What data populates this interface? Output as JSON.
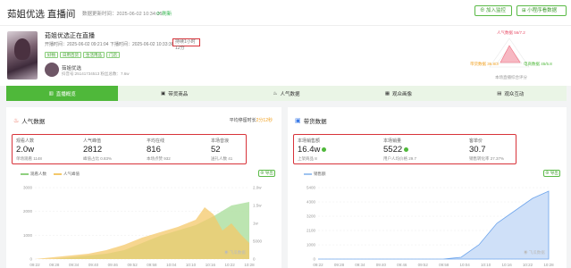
{
  "header": {
    "title": "茹姐优选  直播间",
    "updated": "数据更新时间：2025-06-02 10:34:25",
    "refresh": "⟳ 刷新",
    "follow": "⊕ 加入监控",
    "compare": "⊞ 小程序看数据"
  },
  "info": {
    "live_title": "茹姐优选正在直播",
    "start": "开播时间：2025-06-02 09:21:04",
    "end": "下播时间：2025-06-02 10:33:36",
    "duration": "持续1小时12分",
    "tags": [
      "好物",
      "日用百货",
      "生活用品",
      "门店"
    ],
    "shop": "茹姐优选",
    "shop_sub": "抖音号:25141734513   粉丝总数：7.6w",
    "radar": {
      "top": "人气数据 56/7.2",
      "left": "带货数据 36.8/3",
      "right": "电商数据 45/5.8",
      "bottom": "本场直播综合评分"
    }
  },
  "tabs": [
    "直播概览",
    "带货商品",
    "人气数据",
    "观众画像",
    "观众互动"
  ],
  "left": {
    "title": "人气数据",
    "right_note": "平均停留时长",
    "right_val": "2分12秒",
    "stats": [
      {
        "label": "观看人数",
        "value": "2.0w",
        "sub": "单场观看 1148"
      },
      {
        "label": "人气峰值",
        "value": "2812",
        "sub": "峰值占比 0.83%"
      },
      {
        "label": "平均在线",
        "value": "816",
        "sub": "本场点赞 932"
      },
      {
        "label": "本场音浪",
        "value": "52",
        "sub": "送礼人数 41"
      }
    ],
    "legend": [
      "观看人数",
      "人气峰值"
    ],
    "export": "⊕ 导出",
    "x_ticks": [
      "09:22",
      "09:28",
      "09:34",
      "09:40",
      "09:46",
      "09:52",
      "09:58",
      "10:04",
      "10:10",
      "10:16",
      "10:22",
      "10:28"
    ],
    "y_left": [
      "3000",
      "2000",
      "1000",
      "0"
    ],
    "y_right": [
      "2.0w",
      "1.5w",
      "1w",
      "5000",
      "0"
    ]
  },
  "right": {
    "title": "带货数据",
    "stats": [
      {
        "label": "本场销售额",
        "value": "16.4w",
        "sub": "上架商品 8"
      },
      {
        "label": "本场销量",
        "value": "5522",
        "sub": "用户人均价格 29.7"
      },
      {
        "label": "客单价",
        "value": "30.7",
        "sub": "销售转化率 27.37%"
      }
    ],
    "legend": [
      "销售额"
    ],
    "export": "⊕ 导出",
    "x_ticks": [
      "09:22",
      "09:28",
      "09:34",
      "09:40",
      "09:46",
      "09:52",
      "09:58",
      "10:04",
      "10:10",
      "10:16",
      "10:22",
      "10:28"
    ],
    "y_left": [
      "5400",
      "4300",
      "3200",
      "2100",
      "1000",
      "0"
    ]
  },
  "colors": {
    "accent": "#4fb83a",
    "highlight": "#d8333a",
    "area1": "#8fd07f",
    "area2": "#f4c86a"
  }
}
